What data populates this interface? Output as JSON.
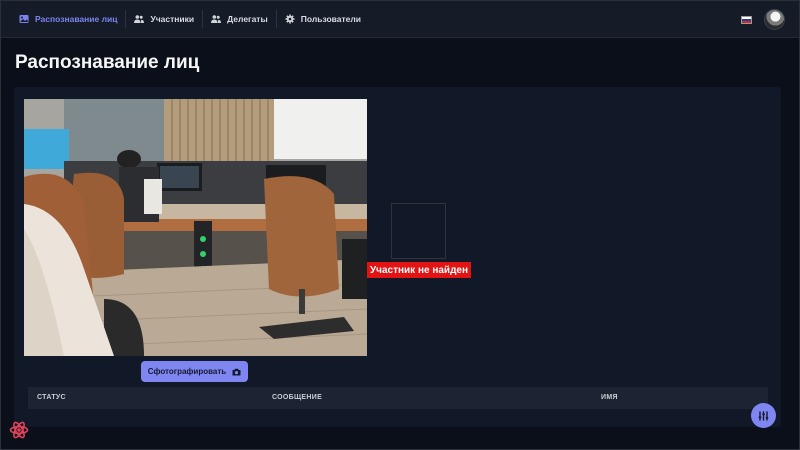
{
  "nav": {
    "items": [
      {
        "label": "Распознавание лиц",
        "icon": "image-icon",
        "active": true
      },
      {
        "label": "Участники",
        "icon": "users-icon",
        "active": false
      },
      {
        "label": "Делегаты",
        "icon": "users-icon",
        "active": false
      },
      {
        "label": "Пользователи",
        "icon": "gear-icon",
        "active": false
      }
    ],
    "language_flag": "ru-flag-icon"
  },
  "page": {
    "title": "Распознавание лиц"
  },
  "recognition": {
    "status_label": "Участник не найден",
    "capture_button_label": "Сфотографировать",
    "capture_icon": "camera-icon"
  },
  "table": {
    "columns": [
      "СТАТУС",
      "СООБЩЕНИЕ",
      "ИМЯ"
    ],
    "rows": []
  },
  "colors": {
    "accent": "#7f86f2",
    "background": "#0b0f19",
    "card": "#111827",
    "error": "#e11313"
  }
}
